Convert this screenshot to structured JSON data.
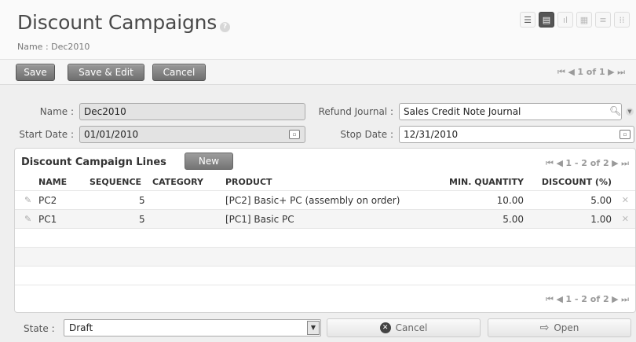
{
  "header": {
    "title": "Discount Campaigns",
    "help_symbol": "?",
    "subtitle": "Name : Dec2010"
  },
  "view_switch": [
    "list-view-icon",
    "form-view-icon",
    "graph-view-icon",
    "calendar-view-icon",
    "gantt-view-icon",
    "diagram-view-icon"
  ],
  "toolbar": {
    "save_label": "Save",
    "save_edit_label": "Save & Edit",
    "cancel_label": "Cancel",
    "pager_first": "⏮",
    "pager_prev": "◀",
    "pager_text": "1 of 1",
    "pager_next": "▶",
    "pager_last": "⏭"
  },
  "form": {
    "name_label": "Name :",
    "name_value": "Dec2010",
    "refund_journal_label": "Refund Journal :",
    "refund_journal_value": "Sales Credit Note Journal",
    "start_date_label": "Start Date :",
    "start_date_value": "01/01/2010",
    "stop_date_label": "Stop Date :",
    "stop_date_value": "12/31/2010"
  },
  "lines": {
    "title": "Discount Campaign Lines",
    "new_label": "New",
    "pager_text": "1 - 2 of 2",
    "columns": {
      "name": "NAME",
      "sequence": "SEQUENCE",
      "category": "CATEGORY",
      "product": "PRODUCT",
      "min_quantity": "MIN. QUANTITY",
      "discount": "DISCOUNT (%)"
    },
    "rows": [
      {
        "name": "PC2",
        "sequence": "5",
        "category": "",
        "product": "[PC2] Basic+ PC (assembly on order)",
        "min_quantity": "10.00",
        "discount": "5.00"
      },
      {
        "name": "PC1",
        "sequence": "5",
        "category": "",
        "product": "[PC1] Basic PC",
        "min_quantity": "5.00",
        "discount": "1.00"
      }
    ]
  },
  "footer": {
    "state_label": "State :",
    "state_value": "Draft",
    "cancel_label": "Cancel",
    "open_label": "Open"
  }
}
